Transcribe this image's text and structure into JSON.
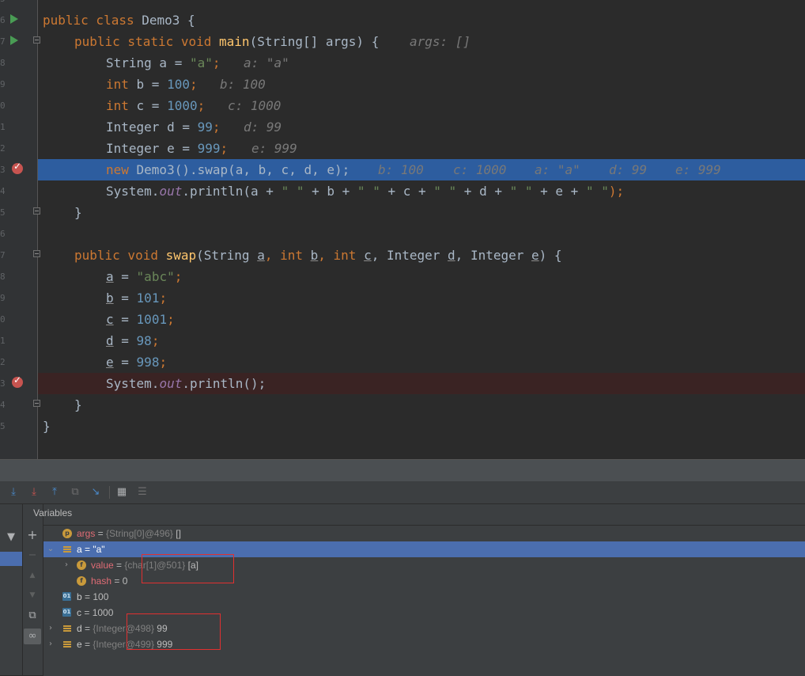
{
  "editor": {
    "gutter_digits": [
      "5",
      "6",
      "7",
      "8",
      "9",
      "0",
      "1",
      "2",
      "3",
      "4",
      "5",
      "6",
      "7",
      "8",
      "9",
      "0",
      "1",
      "2",
      "3",
      "4",
      "5"
    ],
    "lines": {
      "l1": {
        "kw": "public class ",
        "name": "Demo3 {"
      },
      "l2": {
        "kw1": "public static void ",
        "fn": "main",
        "rest": "(String[] args) {",
        "hint": "args: []"
      },
      "l3": {
        "text": "String a = ",
        "str": "\"a\"",
        "end": ";",
        "hint": "a: \"a\""
      },
      "l4": {
        "kw": "int ",
        "text": "b = ",
        "num": "100",
        "end": ";",
        "hint": "b: 100"
      },
      "l5": {
        "kw": "int ",
        "text": "c = ",
        "num": "1000",
        "end": ";",
        "hint": "c: 1000"
      },
      "l6": {
        "text": "Integer d = ",
        "num": "99",
        "end": ";",
        "hint": "d: 99"
      },
      "l7": {
        "text": "Integer e = ",
        "num": "999",
        "end": ";",
        "hint": "e: 999"
      },
      "l8": {
        "kw": "new ",
        "text": "Demo3().swap(a, b, c, d, e);",
        "hints": [
          "b: 100",
          "c: 1000",
          "a: \"a\"",
          "d: 99",
          "e: 999"
        ]
      },
      "l9": {
        "a": "System.",
        "out": "out",
        "b": ".println(a + ",
        "s1": "\" \"",
        "c": " + b + ",
        "s2": "\" \"",
        "d": " + c + ",
        "s3": "\" \"",
        "e": " + d + ",
        "s4": "\" \"",
        "f": " + e + ",
        "s5": "\" \"",
        "g": ");"
      },
      "l10": {
        "text": "}"
      },
      "l12": {
        "kw": "public void ",
        "fn": "swap",
        "p0": "(String ",
        "a": "a",
        "p1": ", ",
        "kw2": "int ",
        "b": "b",
        "p2": ", ",
        "kw3": "int ",
        "c": "c",
        "p3": ", Integer ",
        "d": "d",
        "p4": ", Integer ",
        "e": "e",
        "p5": ") {"
      },
      "l13": {
        "v": "a",
        "eq": " = ",
        "str": "\"abc\"",
        "end": ";"
      },
      "l14": {
        "v": "b",
        "eq": " = ",
        "num": "101",
        "end": ";"
      },
      "l15": {
        "v": "c",
        "eq": " = ",
        "num": "1001",
        "end": ";"
      },
      "l16": {
        "v": "d",
        "eq": " = ",
        "num": "98",
        "end": ";"
      },
      "l17": {
        "v": "e",
        "eq": " = ",
        "num": "998",
        "end": ";"
      },
      "l18": {
        "a": "System.",
        "out": "out",
        "b": ".println();"
      },
      "l19": {
        "text": "}"
      },
      "l20": {
        "text": "}"
      }
    }
  },
  "debugger": {
    "panel_title": "Variables",
    "variables": [
      {
        "name": "args",
        "type": "{String[0]@496}",
        "value": "[]"
      },
      {
        "name": "a",
        "eq": " = ",
        "value": "\"a\""
      },
      {
        "name": "value",
        "type": "{char[1]@501}",
        "value": "[a]"
      },
      {
        "name": "hash",
        "value": "0"
      },
      {
        "name": "b",
        "value": "100"
      },
      {
        "name": "c",
        "value": "1000"
      },
      {
        "name": "d",
        "type": "{Integer@498}",
        "value": "99"
      },
      {
        "name": "e",
        "type": "{Integer@499}",
        "value": "999"
      }
    ]
  },
  "colors": {
    "exec_line": "#2d5d9f",
    "breakpoint": "#c75450",
    "keyword": "#cc7832",
    "string": "#6a8759",
    "number": "#6897bb",
    "selected_row": "#4b6eaf",
    "annotation_box": "#e03030"
  }
}
